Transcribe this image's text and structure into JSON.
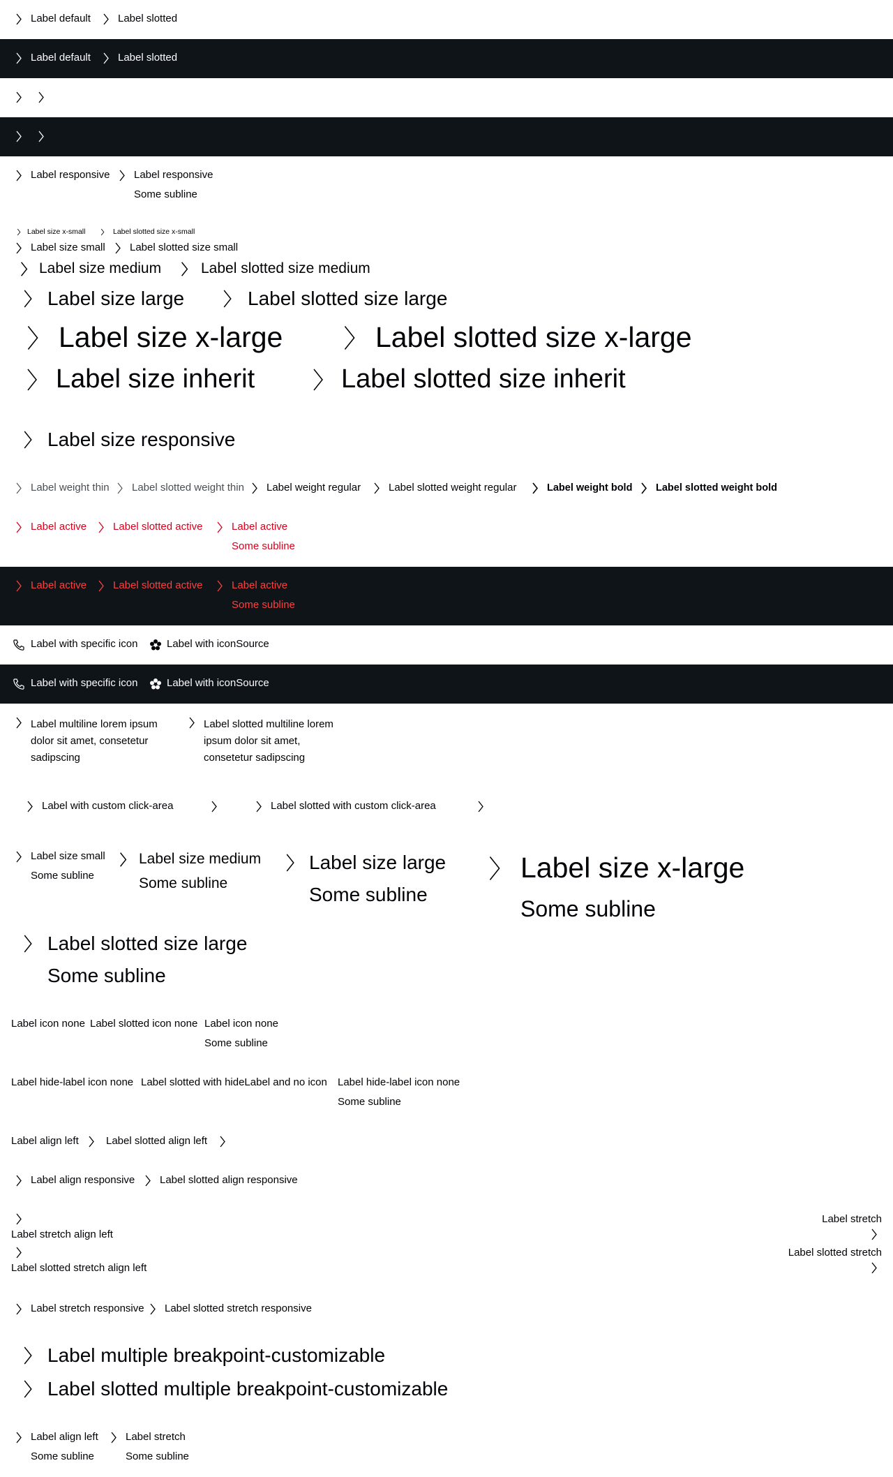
{
  "colors": {
    "text": "#010205",
    "dark_bg": "#0e1418",
    "dark_text": "#fbfcff",
    "active": "#d5001c",
    "active_dark": "#fc4040"
  },
  "icons": {
    "arrow": "arrow-right-icon",
    "phone": "phone-icon",
    "custom": "flower-icon"
  },
  "basic": {
    "label_default": "Label default",
    "label_slotted": "Label slotted"
  },
  "responsive": {
    "label": "Label responsive",
    "label_slotted": "Label responsive",
    "subline": "Some subline"
  },
  "sizes": {
    "xsmall": "Label size x-small",
    "xsmall_slotted": "Label slotted size x-small",
    "small": "Label size small",
    "small_slotted": "Label slotted size small",
    "medium": "Label size medium",
    "medium_slotted": "Label slotted size medium",
    "large": "Label size large",
    "large_slotted": "Label slotted size large",
    "xlarge": "Label size x-large",
    "xlarge_slotted": "Label slotted size x-large",
    "inherit": "Label size inherit",
    "inherit_slotted": "Label slotted size inherit",
    "responsive": "Label size responsive"
  },
  "weights": {
    "thin": "Label weight thin",
    "thin_slotted": "Label slotted weight thin",
    "regular": "Label weight regular",
    "regular_slotted": "Label slotted weight regular",
    "bold": "Label weight bold",
    "bold_slotted": "Label slotted weight bold"
  },
  "active": {
    "label": "Label active",
    "label_slotted": "Label slotted active",
    "label_sub": "Label active",
    "subline": "Some subline"
  },
  "icon_links": {
    "specific": "Label with specific icon",
    "source": "Label with iconSource"
  },
  "multiline": {
    "label": "Label multiline lorem ipsum dolor sit amet, consetetur sadipscing",
    "label_slotted": "Label slotted multiline lorem ipsum dolor sit amet, consetetur sadipscing"
  },
  "click_area": {
    "label": "Label with custom click-area",
    "label_slotted": "Label slotted with custom click-area"
  },
  "size_sublines": {
    "small": "Label size small",
    "medium": "Label size medium",
    "large": "Label size large",
    "xlarge": "Label size x-large",
    "slotted_large": "Label slotted size large",
    "subline": "Some subline"
  },
  "icon_none": {
    "label": "Label icon none",
    "label_slotted": "Label slotted icon none",
    "label_sub": "Label icon none",
    "subline": "Some subline"
  },
  "hide_label": {
    "label": "Label hide-label icon none",
    "label_slotted": "Label slotted with hideLabel and no icon",
    "label_sub": "Label hide-label icon none",
    "subline": "Some subline"
  },
  "align_left": {
    "label": "Label align left",
    "label_slotted": "Label slotted align left"
  },
  "align_responsive": {
    "label": "Label align responsive",
    "label_slotted": "Label slotted align responsive"
  },
  "stretch": {
    "left": "Label stretch align left",
    "left_slotted": "Label slotted stretch align left",
    "right": "Label stretch",
    "right_slotted": "Label slotted stretch"
  },
  "stretch_responsive": {
    "label": "Label stretch responsive",
    "label_slotted": "Label slotted stretch responsive"
  },
  "breakpoint": {
    "label": "Label multiple breakpoint-customizable",
    "label_slotted": "Label slotted multiple breakpoint-customizable"
  },
  "last": {
    "align_left": "Label align left",
    "stretch": "Label stretch",
    "subline": "Some subline"
  }
}
